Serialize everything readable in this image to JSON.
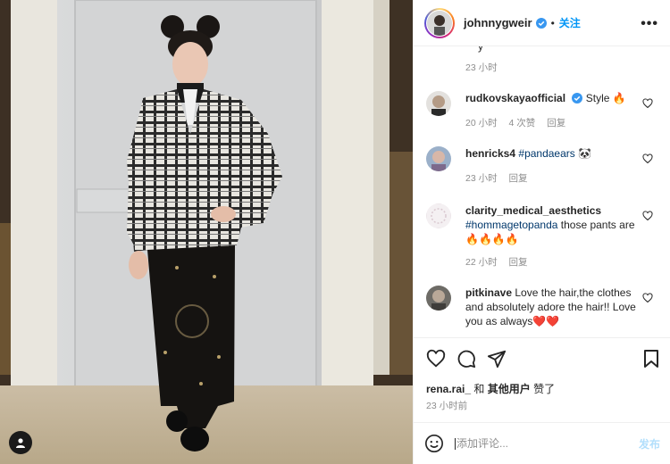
{
  "post": {
    "username": "johnnygweir",
    "follow_label": "关注",
    "more_label": "•••"
  },
  "first_comment_time": "23 小时",
  "first_comment_tail": "y",
  "comments": [
    {
      "username": "rudkovskayaofficial",
      "verified": true,
      "text": "Style 🔥",
      "time": "20 小时",
      "likes": "4 次赞",
      "reply": "回复"
    },
    {
      "username": "henricks4",
      "tag": "#pandaears",
      "text": "🐼",
      "time": "23 小时",
      "reply": "回复"
    },
    {
      "username": "clarity_medical_aesthetics",
      "tag": "#hommagetopanda",
      "text": "those pants are",
      "text2": "🔥🔥🔥🔥",
      "time": "22 小时",
      "reply": "回复"
    },
    {
      "username": "pitkinave",
      "text": "Love the hair,the clothes and absolutely adore the hair!! Love you as always❤️❤️",
      "time": "23 小时",
      "reply": "回复"
    }
  ],
  "likes_line": {
    "user": "rena.rai_",
    "connector": "和",
    "others": "其他用户",
    "suffix": "赞了"
  },
  "post_time": "23 小时前",
  "comment_box": {
    "placeholder": "添加评论...",
    "post_label": "发布"
  },
  "icons": {
    "heart": "heart-icon",
    "comment": "comment-icon",
    "share": "share-icon",
    "save": "bookmark-icon",
    "emoji": "emoji-icon",
    "verified": "verified-badge-icon",
    "user_tag": "user-tag-icon"
  },
  "colors": {
    "accent": "#0095f6",
    "tag": "#00376b",
    "muted": "#8e8e8e",
    "post_disabled": "#b2dffc"
  }
}
